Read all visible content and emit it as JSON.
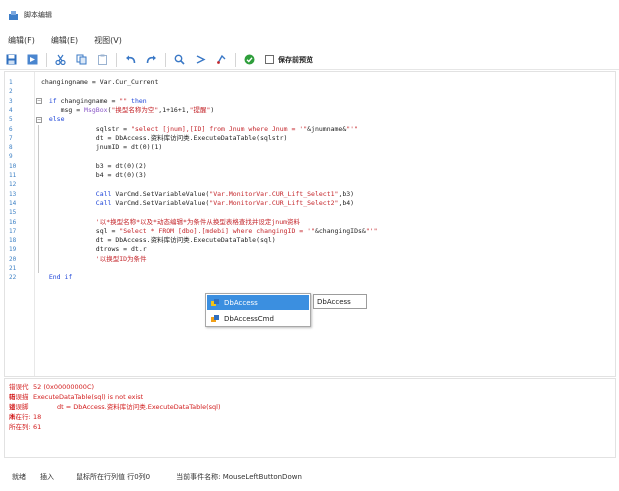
{
  "window": {
    "title": "脚本编辑"
  },
  "menu": [
    "编辑(F)",
    "编辑(E)",
    "视图(V)"
  ],
  "toolbar": {
    "buttons": [
      {
        "name": "save-icon",
        "glyph": "▙",
        "color": "#2f6fbf"
      },
      {
        "name": "save-all-icon",
        "glyph": "⏵",
        "color": "#2f6fbf"
      },
      {
        "name": "cut-icon",
        "glyph": "✂",
        "color": "#3a78c6"
      },
      {
        "name": "copy-icon",
        "glyph": "❐",
        "color": "#3a78c6"
      },
      {
        "name": "paste-icon",
        "glyph": "⎘",
        "color": "#8aa6c9"
      },
      {
        "name": "undo-icon",
        "glyph": "↶",
        "color": "#3a78c6"
      },
      {
        "name": "redo-icon",
        "glyph": "↷",
        "color": "#3a78c6"
      },
      {
        "name": "find-icon",
        "glyph": "⚲",
        "color": "#3a78c6"
      },
      {
        "name": "find-prev-icon",
        "glyph": "⚭",
        "color": "#3a78c6"
      },
      {
        "name": "replace-icon",
        "glyph": "↯",
        "color": "#3a78c6"
      },
      {
        "name": "check-icon",
        "glyph": "●",
        "color": "#2e9e3b"
      }
    ],
    "save_preview_label": "保存前预览"
  },
  "code": [
    {
      "n": "1",
      "html": "<span>changingname = Var.Cur_Current</span>"
    },
    {
      "n": "2",
      "html": ""
    },
    {
      "n": "3",
      "html": "  <span class=\"kw\">if</span> changingname = <span class=\"str\">\"\"</span> <span class=\"kw\">then</span>"
    },
    {
      "n": "4",
      "html": "     msg = <span class=\"fn\">MsgBox</span>(<span class=\"str\">\"换型名称为空\"</span>,1+16+1,<span class=\"str\">\"提醒\"</span>)"
    },
    {
      "n": "5",
      "html": "  <span class=\"kw\">else</span>"
    },
    {
      "n": "6",
      "html": "              sqlstr = <span class=\"str\">\"select [jnum],[ID] from Jnum where Jnum = '\"</span>&amp;jnumname&amp;<span class=\"str\">\"'\"</span>"
    },
    {
      "n": "7",
      "html": "              dt = DbAccess.资料库访问类.ExecuteDataTable(sqlstr)"
    },
    {
      "n": "8",
      "html": "              jnumID = dt(0)(1)"
    },
    {
      "n": "9",
      "html": ""
    },
    {
      "n": "10",
      "html": "              b3 = dt(0)(2)"
    },
    {
      "n": "11",
      "html": "              b4 = dt(0)(3)"
    },
    {
      "n": "12",
      "html": ""
    },
    {
      "n": "13",
      "html": "              <span class=\"kw\">Call</span> VarCmd.SetVariableValue(<span class=\"str\">\"Var.MonitorVar.CUR_Lift_Select1\"</span>,b3)"
    },
    {
      "n": "14",
      "html": "              <span class=\"kw\">Call</span> VarCmd.SetVariableValue(<span class=\"str\">\"Var.MonitorVar.CUR_Lift_Select2\"</span>,b4)"
    },
    {
      "n": "15",
      "html": ""
    },
    {
      "n": "16",
      "html": "              <span class=\"str\">'以*换型名称*以及*动态编辑*为条件从换型表格查找并设定jnum资料</span>"
    },
    {
      "n": "17",
      "html": "              sql = <span class=\"str\">\"Select * FROM [dbo].[mdebi] where changingID = '\"</span>&amp;changingIDs&amp;<span class=\"str\">\"'\"</span>"
    },
    {
      "n": "18",
      "html": "              dt = DbAccess.资料库访问类.ExecuteDataTable(sql)"
    },
    {
      "n": "19",
      "html": "              dtrows = dt.r"
    },
    {
      "n": "20",
      "html": "              <span class=\"str\">'以换型ID为条件</span>"
    },
    {
      "n": "21",
      "html": ""
    },
    {
      "n": "22",
      "html": "  <span class=\"kw\">End if</span>"
    }
  ],
  "autocomplete": {
    "items": [
      "DbAccess",
      "DbAccessCmd"
    ],
    "tooltip": "DbAccess"
  },
  "errors": [
    {
      "label": "错误代码:",
      "value": "52 (0x00000000C)"
    },
    {
      "label": "错误描述:",
      "value": "ExecuteDataTable(sql) is not exist"
    },
    {
      "label": "错误脚本:",
      "value": "dt = DbAccess.资料库访问类.ExecuteDataTable(sql)"
    },
    {
      "label": "所在行:",
      "value": "18"
    },
    {
      "label": "所在列:",
      "value": "61"
    }
  ],
  "status": {
    "state_label": "就绪",
    "mode": "插入",
    "cursor_event": "鼠标所在行列值 行0列0",
    "event": "当前事件名称: MouseLeftButtonDown"
  }
}
